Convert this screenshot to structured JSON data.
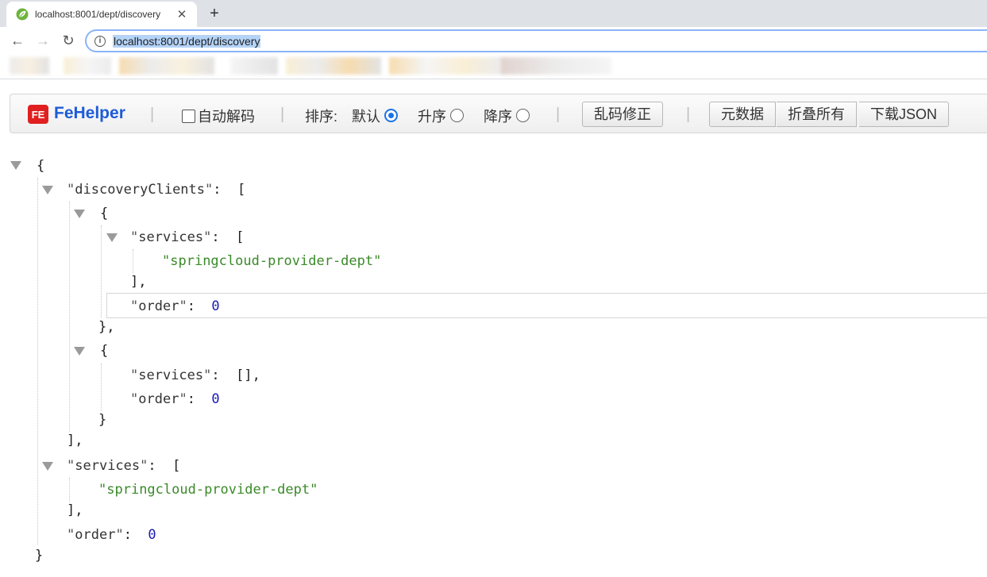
{
  "browser": {
    "tab_title": "localhost:8001/dept/discovery",
    "url": "localhost:8001/dept/discovery",
    "favicon": "spring-leaf-icon",
    "new_tab": "+",
    "close": "✕"
  },
  "fehelper": {
    "logo_text": "FE",
    "title": "FeHelper",
    "auto_decode_label": "自动解码",
    "auto_decode_checked": false,
    "sort_label": "排序:",
    "sort_options": [
      "默认",
      "升序",
      "降序"
    ],
    "sort_selected": "默认",
    "fix_encoding_button": "乱码修正",
    "metadata_button": "元数据",
    "collapse_all_button": "折叠所有",
    "download_json_button": "下载JSON"
  },
  "json": {
    "open_brace": "{",
    "close_brace": "}",
    "discovery_clients_key": "discoveryClients",
    "services_key": "services",
    "order_key": "order",
    "service_value": "springcloud-provider-dept",
    "order_value": "0",
    "empty_array": "[],"
  },
  "colors": {
    "accent": "#1a73e8",
    "fehelper_title": "#1e5bd8",
    "string": "#3a8a29",
    "number": "#1a1ab8"
  }
}
